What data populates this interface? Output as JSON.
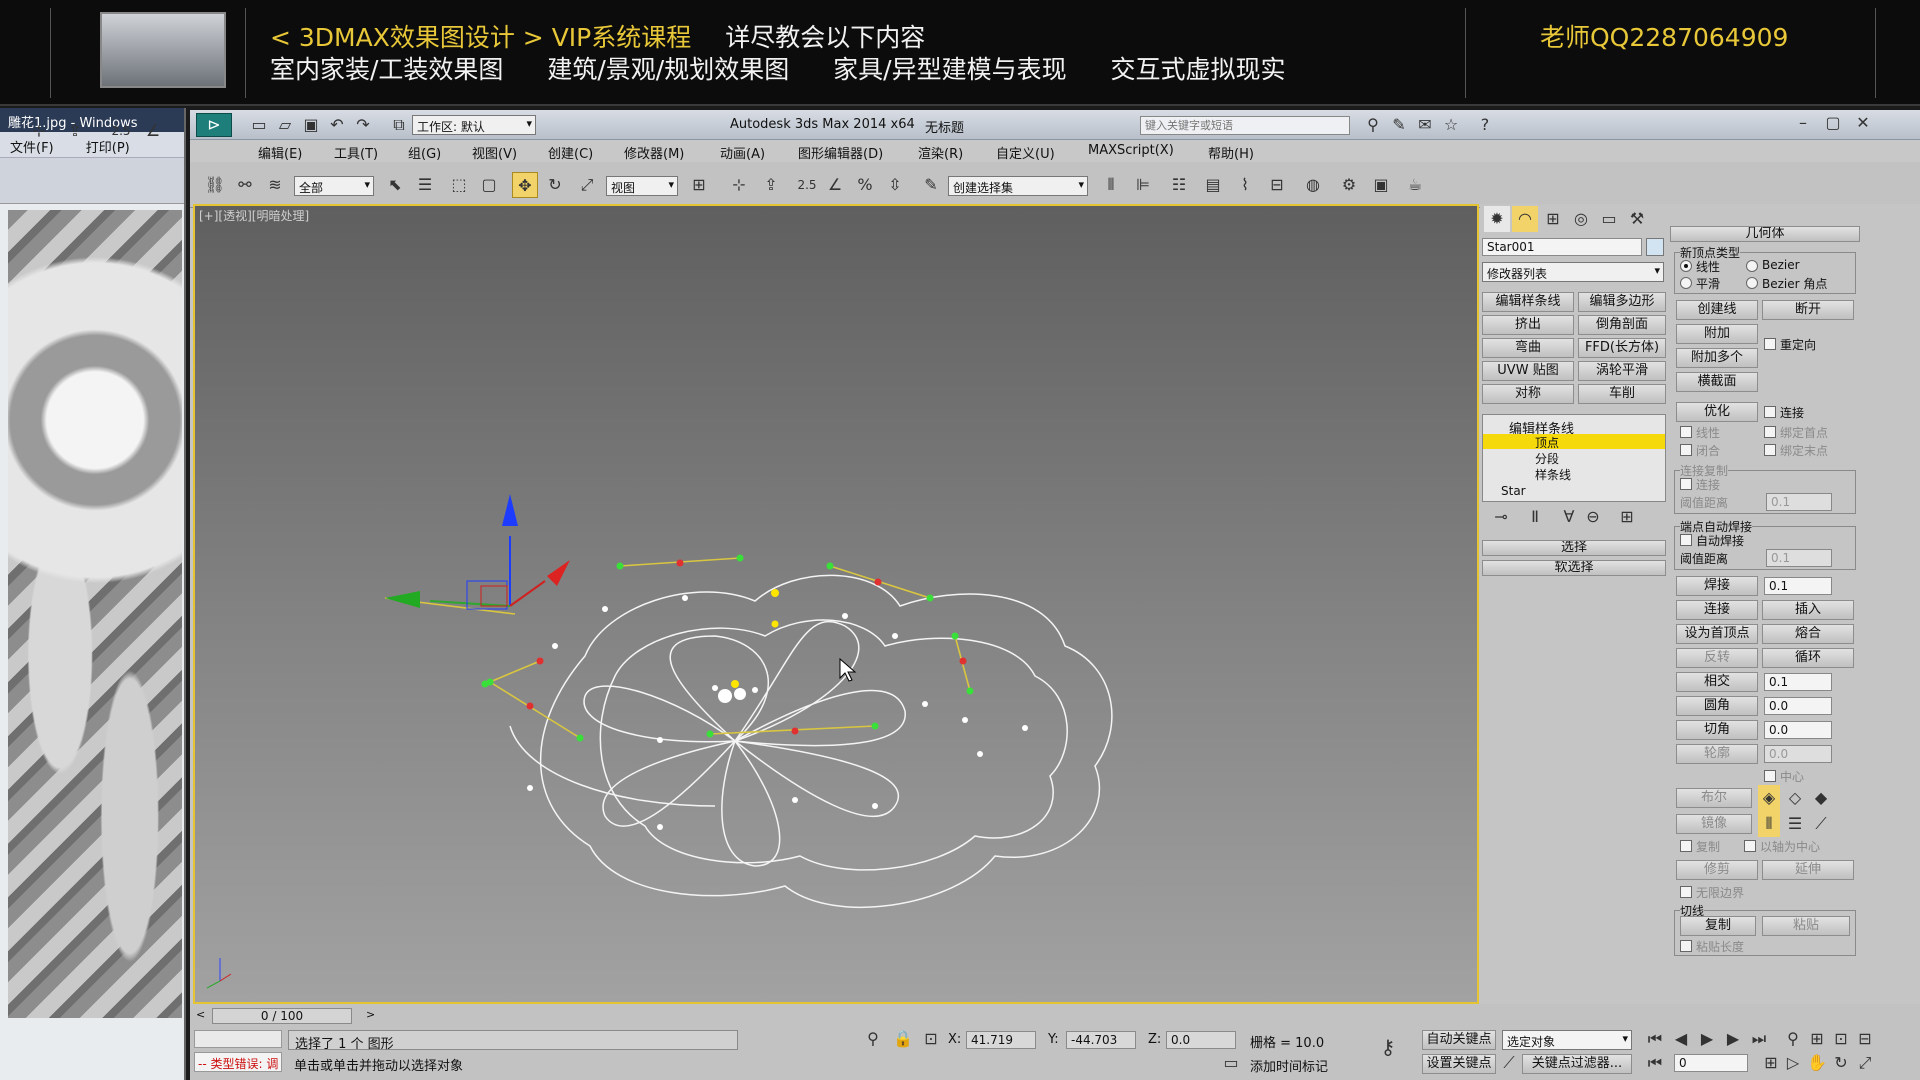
{
  "banner": {
    "line1_prefix": "< 3DMAX效果图设计 > VIP系统课程",
    "line1_suffix": "详尽教会以下内容",
    "line2": "室内家装/工装效果图 建筑/景观/规划效果图 家具/异型建模与表现 交互式虚拟现实",
    "qq": "老师QQ2287064909"
  },
  "viewer": {
    "title": "雕花1.jpg - Windows",
    "menu_file": "文件(F)",
    "menu_print": "打印(P)"
  },
  "app": {
    "title": "Autodesk 3ds Max  2014 x64",
    "doc": "无标题",
    "workspace": "工作区: 默认",
    "search_placeholder": "键入关键字或短语"
  },
  "menu": [
    "编辑(E)",
    "工具(T)",
    "组(G)",
    "视图(V)",
    "创建(C)",
    "修改器(M)",
    "动画(A)",
    "图形编辑器(D)",
    "渲染(R)",
    "自定义(U)",
    "MAXScript(X)",
    "帮助(H)"
  ],
  "toolbar": {
    "filter": "全部",
    "ref_coord": "视图",
    "named_sel": "创建选择集",
    "snap_num": "2.5"
  },
  "viewport": {
    "label": "[+][透视][明暗处理]"
  },
  "command": {
    "object_name": "Star001",
    "modifier_list": "修改器列表",
    "modifier_buttons": [
      "编辑样条线",
      "编辑多边形",
      "挤出",
      "倒角剖面",
      "弯曲",
      "FFD(长方体)",
      "UVW 贴图",
      "涡轮平滑",
      "对称",
      "车削"
    ],
    "stack": {
      "root": "编辑样条线",
      "vertex": "顶点",
      "segment": "分段",
      "spline": "样条线",
      "base": "Star"
    },
    "rollout_select": "选择",
    "rollout_soft": "软选择",
    "geometry": {
      "header": "几何体",
      "new_vertex_type": "新顶点类型",
      "linear": "线性",
      "bezier": "Bezier",
      "smooth": "平滑",
      "bezier_corner": "Bezier 角点",
      "create_line": "创建线",
      "break": "断开",
      "attach": "附加",
      "attach_multi": "附加多个",
      "reorient": "重定向",
      "cross_section": "横截面",
      "refine": "优化",
      "connect": "连接",
      "linear2": "线性",
      "bind_first": "绑定首点",
      "closed": "闭合",
      "bind_last": "绑定末点",
      "connect_copy": "连接复制",
      "connect2": "连接",
      "threshold": "阈值距离",
      "threshold_val": "0.1",
      "end_auto_weld": "端点自动焊接",
      "auto_weld": "自动焊接",
      "threshold2": "阈值距离",
      "threshold2_val": "0.1",
      "weld": "焊接",
      "weld_val": "0.1",
      "connect3": "连接",
      "insert": "插入",
      "make_first": "设为首顶点",
      "fuse": "熔合",
      "reverse": "反转",
      "cycle": "循环",
      "cross_insert": "相交",
      "cross_val": "0.1",
      "fillet": "圆角",
      "fillet_val": "0.0",
      "chamfer": "切角",
      "chamfer_val": "0.0",
      "outline": "轮廓",
      "outline_val": "0.0",
      "center": "中心",
      "boolean": "布尔",
      "mirror": "镜像",
      "copy": "复制",
      "about_pivot": "以轴为中心",
      "trim": "修剪",
      "extend": "延伸",
      "infinite": "无限边界",
      "tangent": "切线",
      "tan_copy": "复制",
      "tan_paste": "粘贴",
      "paste_length": "粘贴长度"
    }
  },
  "status": {
    "timeline": "0 / 100",
    "selected": "选择了 1 个 图形",
    "prompt": "单击或单击并拖动以选择对象",
    "error": "-- 类型错误: 调",
    "x_label": "X:",
    "x": "41.719",
    "y_label": "Y:",
    "y": "-44.703",
    "z_label": "Z:",
    "z": "0.0",
    "grid": "栅格 = 10.0",
    "add_time_tag": "添加时间标记",
    "auto_key": "自动关键点",
    "set_key": "设置关键点",
    "key_sel": "选定对象",
    "key_filter": "关键点过滤器...",
    "frame": "0"
  }
}
